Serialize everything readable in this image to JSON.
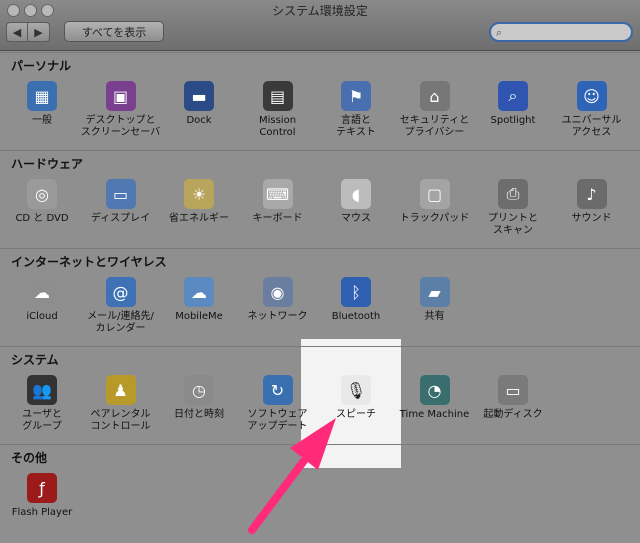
{
  "window": {
    "title": "システム環境設定"
  },
  "toolbar": {
    "back": "◀",
    "forward": "▶",
    "show_all": "すべてを表示",
    "search_placeholder": ""
  },
  "sections": [
    {
      "title": "パーソナル",
      "items": [
        {
          "label": "一般",
          "icon": "general-icon",
          "color": "#3a6fb0",
          "glyph": "▦"
        },
        {
          "label": "デスクトップと\nスクリーンセーバ",
          "icon": "desktop-icon",
          "color": "#7a3f8f",
          "glyph": "▣"
        },
        {
          "label": "Dock",
          "icon": "dock-icon",
          "color": "#2a4b86",
          "glyph": "▬"
        },
        {
          "label": "Mission\nControl",
          "icon": "mission-control-icon",
          "color": "#3a3a3a",
          "glyph": "▤"
        },
        {
          "label": "言語と\nテキスト",
          "icon": "language-icon",
          "color": "#4a6fb0",
          "glyph": "⚑"
        },
        {
          "label": "セキュリティと\nプライバシー",
          "icon": "security-icon",
          "color": "#777777",
          "glyph": "⌂"
        },
        {
          "label": "Spotlight",
          "icon": "spotlight-icon",
          "color": "#2f55b0",
          "glyph": "⌕"
        },
        {
          "label": "ユニバーサル\nアクセス",
          "icon": "universal-access-icon",
          "color": "#2e64b8",
          "glyph": "☺"
        }
      ]
    },
    {
      "title": "ハードウェア",
      "items": [
        {
          "label": "CD と DVD",
          "icon": "cd-dvd-icon",
          "color": "#9a9a9a",
          "glyph": "◎"
        },
        {
          "label": "ディスプレイ",
          "icon": "display-icon",
          "color": "#4f79b0",
          "glyph": "▭"
        },
        {
          "label": "省エネルギー",
          "icon": "energy-saver-icon",
          "color": "#b8a45a",
          "glyph": "☀"
        },
        {
          "label": "キーボード",
          "icon": "keyboard-icon",
          "color": "#a9a9a9",
          "glyph": "⌨"
        },
        {
          "label": "マウス",
          "icon": "mouse-icon",
          "color": "#bcbcbc",
          "glyph": "◖"
        },
        {
          "label": "トラックパッド",
          "icon": "trackpad-icon",
          "color": "#a4a4a4",
          "glyph": "▢"
        },
        {
          "label": "プリントと\nスキャン",
          "icon": "print-scan-icon",
          "color": "#6d6d6d",
          "glyph": "⎙"
        },
        {
          "label": "サウンド",
          "icon": "sound-icon",
          "color": "#6b6b6b",
          "glyph": "♪"
        }
      ]
    },
    {
      "title": "インターネットとワイヤレス",
      "items": [
        {
          "label": "iCloud",
          "icon": "icloud-icon",
          "color": "#8e8e8e",
          "glyph": "☁"
        },
        {
          "label": "メール/連絡先/\nカレンダー",
          "icon": "mail-contacts-icon",
          "color": "#3e72b4",
          "glyph": "@"
        },
        {
          "label": "MobileMe",
          "icon": "mobileme-icon",
          "color": "#5a8ac0",
          "glyph": "☁"
        },
        {
          "label": "ネットワーク",
          "icon": "network-icon",
          "color": "#6a7fa0",
          "glyph": "◉"
        },
        {
          "label": "Bluetooth",
          "icon": "bluetooth-icon",
          "color": "#2f5fb0",
          "glyph": "ᛒ"
        },
        {
          "label": "共有",
          "icon": "sharing-icon",
          "color": "#5b7fa6",
          "glyph": "▰"
        }
      ]
    },
    {
      "title": "システム",
      "items": [
        {
          "label": "ユーザと\nグループ",
          "icon": "users-groups-icon",
          "color": "#333333",
          "glyph": "👥"
        },
        {
          "label": "ペアレンタル\nコントロール",
          "icon": "parental-controls-icon",
          "color": "#b89a2a",
          "glyph": "♟"
        },
        {
          "label": "日付と時刻",
          "icon": "date-time-icon",
          "color": "#8a8a8a",
          "glyph": "◷"
        },
        {
          "label": "ソフトウェア\nアップデート",
          "icon": "software-update-icon",
          "color": "#3a6fb0",
          "glyph": "↻"
        },
        {
          "label": "スピーチ",
          "icon": "microphone-icon",
          "color": "#e9e9e9",
          "glyph": "🎙"
        },
        {
          "label": "Time Machine",
          "icon": "time-machine-icon",
          "color": "#3a6e6e",
          "glyph": "◔"
        },
        {
          "label": "起動ディスク",
          "icon": "startup-disk-icon",
          "color": "#7a7a7a",
          "glyph": "▭"
        }
      ]
    },
    {
      "title": "その他",
      "items": [
        {
          "label": "Flash Player",
          "icon": "flash-player-icon",
          "color": "#9b1a1a",
          "glyph": "ƒ"
        }
      ]
    }
  ]
}
